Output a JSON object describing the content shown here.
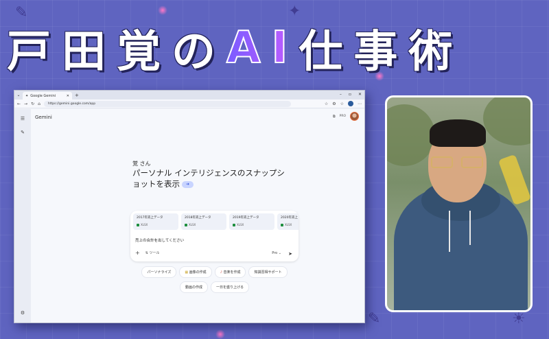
{
  "headline": {
    "part1": "戸田覚の",
    "ai": "AI",
    "part2": "仕事術"
  },
  "browser": {
    "tab_title": "Google Gemini",
    "url": "https://gemini.google.com/app"
  },
  "gemini": {
    "app_title": "Gemini",
    "pro_badge": "PRO",
    "greeting_name": "覚 さん",
    "greeting_line1": "パーソナル インテリジェンスのスナップシ",
    "greeting_line2": "ョットを表示",
    "files": [
      {
        "name": "2017年売上データ",
        "ext": "XLSX"
      },
      {
        "name": "2018年売上データ",
        "ext": "XLSX"
      },
      {
        "name": "2019年売上データ",
        "ext": "XLSX"
      },
      {
        "name": "2020年売上",
        "ext": "XLSX"
      }
    ],
    "prompt": "売上の合計を出してください",
    "tools_label": "ツール",
    "model_label": "Pro",
    "chips": [
      "パーソナライズ",
      "画像の作成",
      "音楽を作成",
      "知識習得サポート",
      "動画の作成",
      "一日を盛り上げる"
    ]
  },
  "icons": {
    "menu": "hamburger-icon",
    "new_chat": "new-chat-icon",
    "settings": "settings-icon",
    "send": "send-icon",
    "plus": "plus-icon"
  }
}
